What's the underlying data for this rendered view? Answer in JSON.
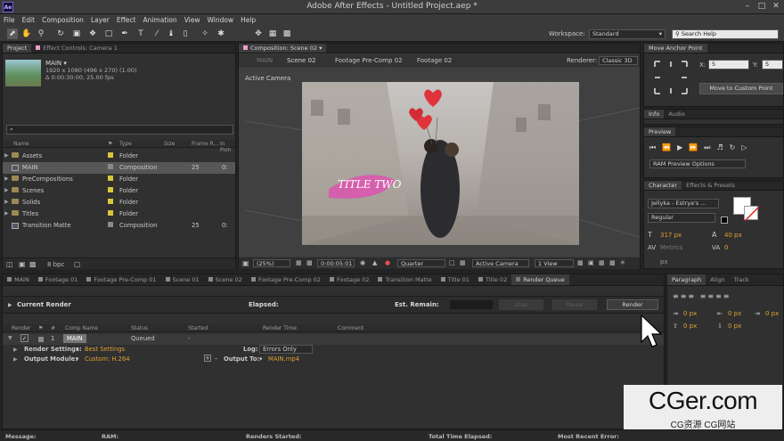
{
  "window": {
    "title": "Adobe After Effects - Untitled Project.aep *",
    "app_icon": "Ae"
  },
  "menu": [
    "File",
    "Edit",
    "Composition",
    "Layer",
    "Effect",
    "Animation",
    "View",
    "Window",
    "Help"
  ],
  "toolbar": {
    "workspace_label": "Workspace:",
    "workspace_value": "Standard",
    "search_placeholder": "Search Help"
  },
  "project_panel": {
    "tabs": [
      "Project",
      "Effect Controls: Camera 1"
    ],
    "preview_name": "MAIN ▾",
    "preview_info": [
      "1920 x 1080  (496 x 270) (1.00)",
      "Δ 0:00:30:00, 25.00 fps"
    ],
    "search_placeholder": "⌕",
    "columns": [
      "Name",
      "Type",
      "Size",
      "Frame R...",
      "In Poin"
    ],
    "items": [
      {
        "name": "Assets",
        "type": "Folder",
        "fr": "",
        "inp": "",
        "icon": "folder",
        "color": "#d9c63a"
      },
      {
        "name": "MAIN",
        "type": "Composition",
        "fr": "25",
        "inp": "0:",
        "icon": "comp",
        "color": "#8a8a8a",
        "selected": true
      },
      {
        "name": "PreCompositions",
        "type": "Folder",
        "fr": "",
        "inp": "",
        "icon": "folder",
        "color": "#d9c63a"
      },
      {
        "name": "Scenes",
        "type": "Folder",
        "fr": "",
        "inp": "",
        "icon": "folder",
        "color": "#d9c63a"
      },
      {
        "name": "Solids",
        "type": "Folder",
        "fr": "",
        "inp": "",
        "icon": "folder",
        "color": "#d9c63a"
      },
      {
        "name": "Titles",
        "type": "Folder",
        "fr": "",
        "inp": "",
        "icon": "folder",
        "color": "#d9c63a"
      },
      {
        "name": "Transition Matte",
        "type": "Composition",
        "fr": "25",
        "inp": "0:",
        "icon": "comp",
        "color": "#8a8a8a"
      }
    ],
    "bpc": "8 bpc"
  },
  "comp_panel": {
    "tab": "Composition: Scene 02",
    "breadcrumbs": [
      "MAIN",
      "Scene 02",
      "Footage Pre-Comp 02",
      "Footage 02"
    ],
    "renderer_label": "Renderer:",
    "renderer_value": "Classic 3D",
    "camera_label": "Active Camera",
    "overlay_text": "TITLE TWO",
    "zoom": "(25%)",
    "timecode": "0:00:05:01",
    "quality": "Quarter",
    "camera": "Active Camera",
    "views": "1 View"
  },
  "right_panels": {
    "anchor_title": "Move Anchor Point",
    "x_label": "X:",
    "x_value": "5",
    "y_label": "Y:",
    "y_value": "5",
    "move_button": "Move to Custom Point",
    "info_tabs": [
      "Info",
      "Audio"
    ],
    "preview_tab": "Preview",
    "ram_preview": "RAM Preview Options",
    "char_tabs": [
      "Character",
      "Effects & Presets"
    ],
    "font_family": "Jellyka - Estrya's ...",
    "font_style": "Regular",
    "font_size": "317 px",
    "leading": "40 px",
    "kerning": "Metrics",
    "tracking": "0",
    "size_unit": "px"
  },
  "timeline": {
    "tabs": [
      "MAIN",
      "Footage 01",
      "Footage Pre-Comp 01",
      "Scene 01",
      "Scene 02",
      "Footage Pre-Comp 02",
      "Footage 02",
      "Transition Matte",
      "Title 01",
      "Title 02",
      "Render Queue"
    ],
    "current_render": "Current Render",
    "elapsed": "Elapsed:",
    "est_remain": "Est. Remain:",
    "stop": "Stop",
    "pause": "Pause",
    "render": "Render",
    "columns": [
      "Render",
      "#",
      "Comp Name",
      "Status",
      "Started",
      "Render Time",
      "Comment"
    ],
    "item": {
      "num": "1",
      "comp": "MAIN",
      "status": "Queued",
      "started": "-"
    },
    "render_settings_label": "Render Settings:",
    "render_settings_value": "Best Settings",
    "log_label": "Log:",
    "log_value": "Errors Only",
    "output_module_label": "Output Module:",
    "output_module_value": "Custom: H.264",
    "output_to_label": "Output To:",
    "output_to_value": "MAIN.mp4"
  },
  "paragraph_panel": {
    "tabs": [
      "Paragraph",
      "Align",
      "Track"
    ],
    "values": [
      "0 px",
      "0 px",
      "0 px",
      "0 px",
      "0 px"
    ]
  },
  "status_bar": [
    "Message:",
    "RAM:",
    "Renders Started:",
    "Total Time Elapsed:",
    "Most Recent Error:"
  ],
  "watermark": {
    "main": "CGer.com",
    "sub": "CG资源  CG网站"
  },
  "colors": {
    "accent_label": "#d9c63a",
    "link_orange": "#e0a030",
    "panel": "#303030",
    "background": "#232323"
  }
}
